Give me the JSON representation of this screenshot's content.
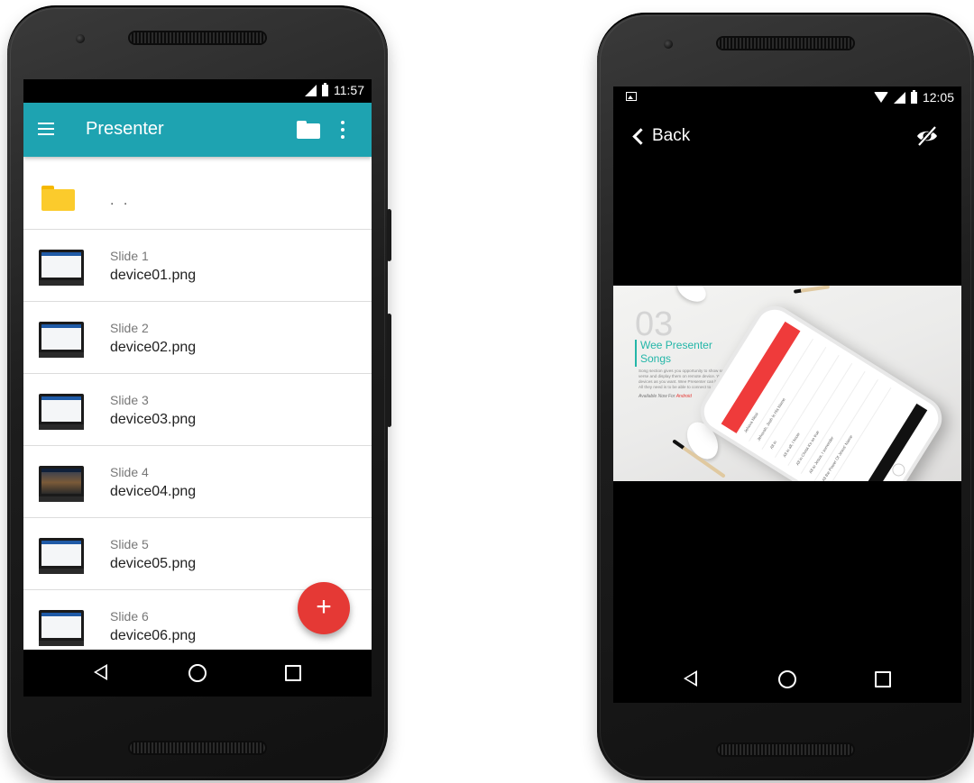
{
  "left_phone": {
    "status_bar": {
      "time": "11:57"
    },
    "app_bar": {
      "title": "Presenter"
    },
    "parent_folder": {
      "label": ". ."
    },
    "files": [
      {
        "slide": "Slide 1",
        "name": "device01.png"
      },
      {
        "slide": "Slide 2",
        "name": "device02.png"
      },
      {
        "slide": "Slide 3",
        "name": "device03.png"
      },
      {
        "slide": "Slide 4",
        "name": "device04.png"
      },
      {
        "slide": "Slide 5",
        "name": "device05.png"
      },
      {
        "slide": "Slide 6",
        "name": "device06.png"
      }
    ],
    "fab": {
      "label": "+"
    },
    "colors": {
      "app_bar": "#1ea3b1",
      "fab": "#e53935",
      "folder": "#fbcb2c"
    }
  },
  "right_phone": {
    "status_bar": {
      "time": "12:05"
    },
    "back": {
      "label": "Back"
    },
    "preview": {
      "number": "03",
      "title_line1": "Wee Presenter",
      "title_line2": "Songs",
      "body": "Song section gives you opportunity to show songs verse by verse and display them on remote device. You can use as many devices as you want. Wee Presenter can handle many of them. All they need is to be able to connect to device URL.",
      "available_prefix": "Available Now For",
      "available_platform": "Android",
      "phone_list": [
        "Jehova Nissi",
        "Jehovah, Jireh Is His Name",
        "All in",
        "All in all, I know",
        "All in Christ it's so true",
        "All to Jesus, I surrender",
        "All the Power Of Jesus' Name"
      ],
      "colors": {
        "accent": "#23b6a8",
        "phone_header": "#ef3b3b"
      }
    }
  },
  "icons": {
    "menu": "menu-icon",
    "folder": "folder-icon",
    "more": "more-vert-icon",
    "back": "chevron-left-icon",
    "visibility_off": "eye-off-icon",
    "nav_back": "nav-back-icon",
    "nav_home": "nav-home-icon",
    "nav_recent": "nav-recent-icon"
  }
}
